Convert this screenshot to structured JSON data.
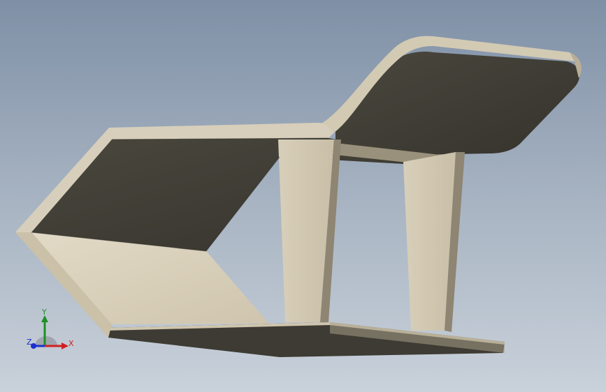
{
  "viewport": {
    "background_top": "#7f90a6",
    "background_bottom": "#c9d1da"
  },
  "model": {
    "name": "lounge-chair",
    "material_colors": {
      "surface_light": "#d6cdb8",
      "surface_edge": "#bfb39c",
      "surface_dark": "#3f3d35",
      "shadow_edge": "#55534a"
    }
  },
  "triad": {
    "x_label": "X",
    "y_label": "Y",
    "z_label": "Z",
    "x_color": "#d12020",
    "y_color": "#1f8f24",
    "z_color": "#1c2fd0"
  }
}
